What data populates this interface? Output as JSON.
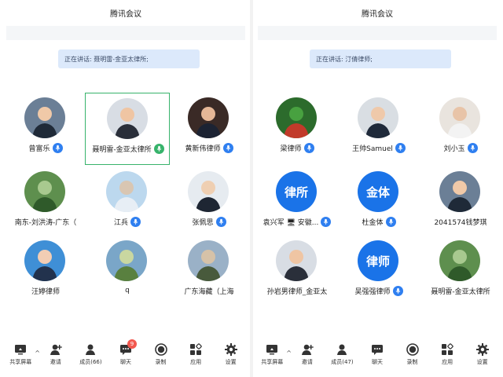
{
  "colors": {
    "accent": "#2f7ff0",
    "speaking_bg": "#dce9fb",
    "active_border": "#37b36b",
    "badge_red": "#f2584f"
  },
  "left": {
    "title": "腾讯会议",
    "speaking": "正在讲话: 聂明雷-金亚太律所;",
    "participants": [
      {
        "name": "曾富乐",
        "avatar": "photo",
        "mic": true,
        "active": false
      },
      {
        "name": "聂明雷-金亚太律所",
        "avatar": "photo",
        "mic": true,
        "mic_on": true,
        "active": true
      },
      {
        "name": "黄新伟律师",
        "avatar": "photo",
        "mic": true,
        "active": false
      },
      {
        "name": "南东-刘洪涛-广东（",
        "avatar": "photo",
        "mic": false,
        "active": false
      },
      {
        "name": "江兵",
        "avatar": "photo",
        "mic": true,
        "active": false
      },
      {
        "name": "张佩思",
        "avatar": "photo",
        "mic": true,
        "active": false
      },
      {
        "name": "汪婷律师",
        "avatar": "photo",
        "mic": false,
        "active": false
      },
      {
        "name": "q",
        "avatar": "photo",
        "mic": false,
        "active": false
      },
      {
        "name": "广东海藏（上海",
        "avatar": "photo",
        "mic": false,
        "active": false
      }
    ],
    "toolbar": [
      {
        "icon": "share-screen-icon",
        "label": "共享屏幕"
      },
      {
        "icon": "invite-icon",
        "label": "邀请"
      },
      {
        "icon": "members-icon",
        "label": "成员(66)"
      },
      {
        "icon": "chat-icon",
        "label": "聊天",
        "badge": "9"
      },
      {
        "icon": "record-icon",
        "label": "录制"
      },
      {
        "icon": "apps-icon",
        "label": "应用"
      },
      {
        "icon": "settings-icon",
        "label": "设置"
      }
    ]
  },
  "right": {
    "title": "腾讯会议",
    "speaking": "正在讲话: 汀倩律师;",
    "participants": [
      {
        "name": "梁律师",
        "avatar": "photo",
        "mic": true,
        "active": false
      },
      {
        "name": "王帅Samuel",
        "avatar": "photo",
        "mic": true,
        "active": false
      },
      {
        "name": "刘小玉",
        "avatar": "photo",
        "mic": true,
        "active": false
      },
      {
        "name": "袁兴军 🖥 安徽...",
        "avatar": "text",
        "avatar_text": "律所",
        "mic": true,
        "active": false
      },
      {
        "name": "杜金体",
        "avatar": "text",
        "avatar_text": "金体",
        "mic": true,
        "active": false
      },
      {
        "name": "2041574钱梦琪",
        "avatar": "photo",
        "mic": false,
        "active": false
      },
      {
        "name": "孙岩男律师_金亚太",
        "avatar": "photo",
        "mic": false,
        "active": false
      },
      {
        "name": "吴强强律师",
        "avatar": "text",
        "avatar_text": "律师",
        "mic": true,
        "active": false
      },
      {
        "name": "聂明雷-金亚太律所",
        "avatar": "photo",
        "mic": false,
        "active": false
      }
    ],
    "toolbar": [
      {
        "icon": "share-screen-icon",
        "label": "共享屏幕"
      },
      {
        "icon": "invite-icon",
        "label": "邀请"
      },
      {
        "icon": "members-icon",
        "label": "成员(47)"
      },
      {
        "icon": "chat-icon",
        "label": "聊天"
      },
      {
        "icon": "record-icon",
        "label": "录制"
      },
      {
        "icon": "apps-icon",
        "label": "应用"
      },
      {
        "icon": "settings-icon",
        "label": "设置"
      }
    ]
  }
}
